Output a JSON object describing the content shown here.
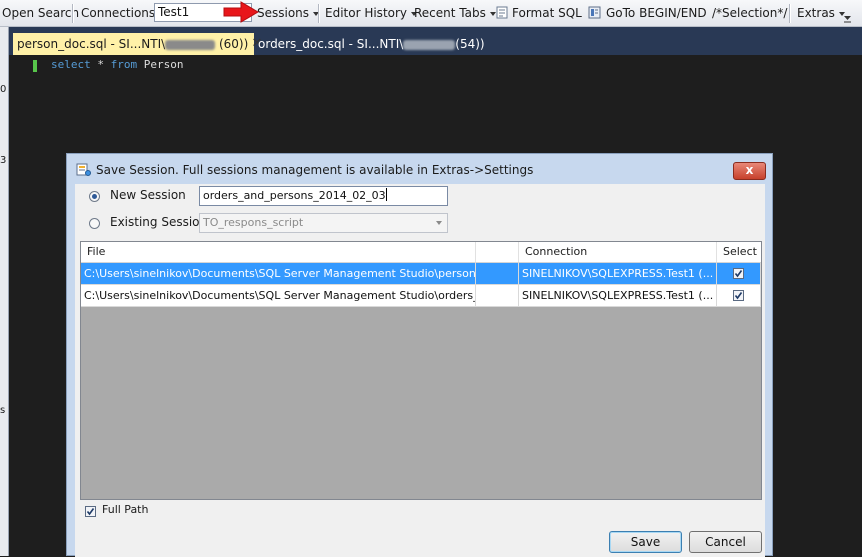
{
  "toolbar": {
    "open_search": "Open Search",
    "connections": "Connections",
    "connection_value": "Test1",
    "sessions": "Sessions",
    "editor_history": "Editor History",
    "recent_tabs": "Recent Tabs",
    "format_sql": "Format SQL",
    "goto": "GoTo BEGIN/END",
    "selection": "/*Selection*/",
    "extras": "Extras"
  },
  "tabs": {
    "active_prefix": "person_doc.sql - SI...NTI\\",
    "active_suffix": " (60))",
    "inactive_prefix": "orders_doc.sql - SI...NTI\\",
    "inactive_suffix": "(54))"
  },
  "editor": {
    "kw_select": "select",
    "star": " * ",
    "kw_from": "from",
    "table": " Person"
  },
  "edge_digits": [
    "0",
    "3",
    "s"
  ],
  "dialog": {
    "title": "Save Session.  Full sessions management is available in Extras->Settings",
    "close_label": "x",
    "new_session_label": "New Session",
    "new_session_value": "orders_and_persons_2014_02_03",
    "existing_session_label": "Existing Session",
    "existing_session_value": "TO_respons_script",
    "columns": [
      "File",
      "",
      "Connection",
      "Select"
    ],
    "rows": [
      {
        "file": "C:\\Users\\sinelnikov\\Documents\\SQL Server Management Studio\\person_doc....",
        "connection": "SINELNIKOV\\SQLEXPRESS.Test1 (...",
        "selected": true
      },
      {
        "file": "C:\\Users\\sinelnikov\\Documents\\SQL Server Management Studio\\orders_doc.sql",
        "connection": "SINELNIKOV\\SQLEXPRESS.Test1 (...",
        "selected": true
      }
    ],
    "full_path_label": "Full Path",
    "save_label": "Save",
    "cancel_label": "Cancel"
  },
  "colors": {
    "editor_bg": "#1e1e1e",
    "tab_active": "#fff1a8",
    "tab_strip": "#293955",
    "selection": "#3399ff",
    "arrow": "#e8161a"
  }
}
